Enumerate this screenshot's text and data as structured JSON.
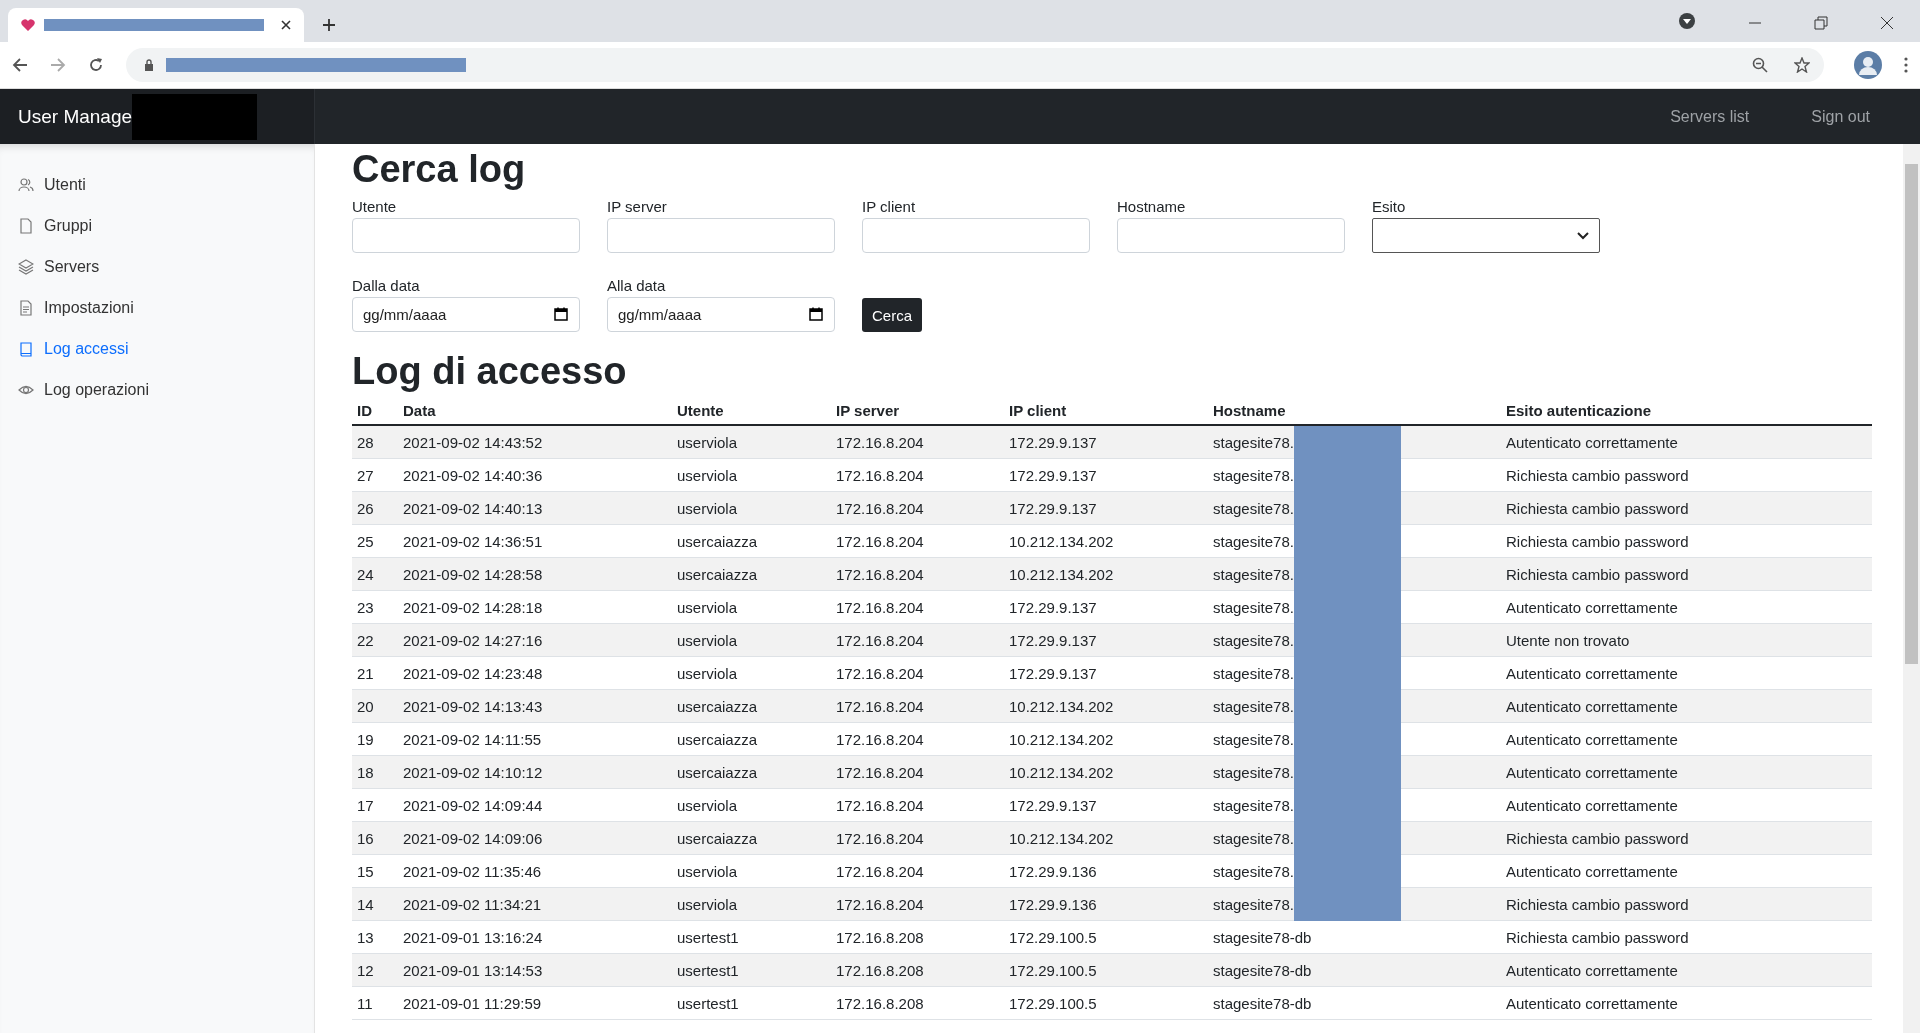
{
  "navbar": {
    "brand": "User Manage",
    "links": [
      "Servers list",
      "Sign out"
    ]
  },
  "sidebar": {
    "items": [
      {
        "label": "Utenti",
        "selected": false
      },
      {
        "label": "Gruppi",
        "selected": false
      },
      {
        "label": "Servers",
        "selected": false
      },
      {
        "label": "Impostazioni",
        "selected": false
      },
      {
        "label": "Log accessi",
        "selected": true
      },
      {
        "label": "Log operazioni",
        "selected": false
      }
    ]
  },
  "search": {
    "title": "Cerca log",
    "fields": [
      {
        "label": "Utente",
        "kind": "text"
      },
      {
        "label": "IP server",
        "kind": "text"
      },
      {
        "label": "IP client",
        "kind": "text"
      },
      {
        "label": "Hostname",
        "kind": "text"
      },
      {
        "label": "Esito",
        "kind": "select"
      }
    ],
    "date_fields": [
      {
        "label": "Dalla data",
        "placeholder": "gg/mm/aaaa"
      },
      {
        "label": "Alla data",
        "placeholder": "gg/mm/aaaa"
      }
    ],
    "button": "Cerca"
  },
  "table": {
    "title": "Log di accesso",
    "columns": [
      "ID",
      "Data",
      "Utente",
      "IP server",
      "IP client",
      "Hostname",
      "Esito autenticazione"
    ],
    "rows": [
      {
        "id": "28",
        "date": "2021-09-02 14:43:52",
        "user": "userviola",
        "ip_server": "172.16.8.204",
        "ip_client": "172.29.9.137",
        "hostname": "stagesite78.",
        "redacted": true,
        "outcome": "Autenticato correttamente"
      },
      {
        "id": "27",
        "date": "2021-09-02 14:40:36",
        "user": "userviola",
        "ip_server": "172.16.8.204",
        "ip_client": "172.29.9.137",
        "hostname": "stagesite78.",
        "redacted": true,
        "outcome": "Richiesta cambio password"
      },
      {
        "id": "26",
        "date": "2021-09-02 14:40:13",
        "user": "userviola",
        "ip_server": "172.16.8.204",
        "ip_client": "172.29.9.137",
        "hostname": "stagesite78.",
        "redacted": true,
        "outcome": "Richiesta cambio password"
      },
      {
        "id": "25",
        "date": "2021-09-02 14:36:51",
        "user": "usercaiazza",
        "ip_server": "172.16.8.204",
        "ip_client": "10.212.134.202",
        "hostname": "stagesite78.",
        "redacted": true,
        "outcome": "Richiesta cambio password"
      },
      {
        "id": "24",
        "date": "2021-09-02 14:28:58",
        "user": "usercaiazza",
        "ip_server": "172.16.8.204",
        "ip_client": "10.212.134.202",
        "hostname": "stagesite78.",
        "redacted": true,
        "outcome": "Richiesta cambio password"
      },
      {
        "id": "23",
        "date": "2021-09-02 14:28:18",
        "user": "userviola",
        "ip_server": "172.16.8.204",
        "ip_client": "172.29.9.137",
        "hostname": "stagesite78.",
        "redacted": true,
        "outcome": "Autenticato correttamente"
      },
      {
        "id": "22",
        "date": "2021-09-02 14:27:16",
        "user": "userviola",
        "ip_server": "172.16.8.204",
        "ip_client": "172.29.9.137",
        "hostname": "stagesite78.",
        "redacted": true,
        "outcome": "Utente non trovato"
      },
      {
        "id": "21",
        "date": "2021-09-02 14:23:48",
        "user": "userviola",
        "ip_server": "172.16.8.204",
        "ip_client": "172.29.9.137",
        "hostname": "stagesite78.",
        "redacted": true,
        "outcome": "Autenticato correttamente"
      },
      {
        "id": "20",
        "date": "2021-09-02 14:13:43",
        "user": "usercaiazza",
        "ip_server": "172.16.8.204",
        "ip_client": "10.212.134.202",
        "hostname": "stagesite78.",
        "redacted": true,
        "outcome": "Autenticato correttamente"
      },
      {
        "id": "19",
        "date": "2021-09-02 14:11:55",
        "user": "usercaiazza",
        "ip_server": "172.16.8.204",
        "ip_client": "10.212.134.202",
        "hostname": "stagesite78.",
        "redacted": true,
        "outcome": "Autenticato correttamente"
      },
      {
        "id": "18",
        "date": "2021-09-02 14:10:12",
        "user": "usercaiazza",
        "ip_server": "172.16.8.204",
        "ip_client": "10.212.134.202",
        "hostname": "stagesite78.",
        "redacted": true,
        "outcome": "Autenticato correttamente"
      },
      {
        "id": "17",
        "date": "2021-09-02 14:09:44",
        "user": "userviola",
        "ip_server": "172.16.8.204",
        "ip_client": "172.29.9.137",
        "hostname": "stagesite78.",
        "redacted": true,
        "outcome": "Autenticato correttamente"
      },
      {
        "id": "16",
        "date": "2021-09-02 14:09:06",
        "user": "usercaiazza",
        "ip_server": "172.16.8.204",
        "ip_client": "10.212.134.202",
        "hostname": "stagesite78.",
        "redacted": true,
        "outcome": "Richiesta cambio password"
      },
      {
        "id": "15",
        "date": "2021-09-02 11:35:46",
        "user": "userviola",
        "ip_server": "172.16.8.204",
        "ip_client": "172.29.9.136",
        "hostname": "stagesite78.",
        "redacted": true,
        "outcome": "Autenticato correttamente"
      },
      {
        "id": "14",
        "date": "2021-09-02 11:34:21",
        "user": "userviola",
        "ip_server": "172.16.8.204",
        "ip_client": "172.29.9.136",
        "hostname": "stagesite78.",
        "redacted": true,
        "outcome": "Richiesta cambio password"
      },
      {
        "id": "13",
        "date": "2021-09-01 13:16:24",
        "user": "usertest1",
        "ip_server": "172.16.8.208",
        "ip_client": "172.29.100.5",
        "hostname": "stagesite78-db",
        "redacted": false,
        "outcome": "Richiesta cambio password"
      },
      {
        "id": "12",
        "date": "2021-09-01 13:14:53",
        "user": "usertest1",
        "ip_server": "172.16.8.208",
        "ip_client": "172.29.100.5",
        "hostname": "stagesite78-db",
        "redacted": false,
        "outcome": "Autenticato correttamente"
      },
      {
        "id": "11",
        "date": "2021-09-01 11:29:59",
        "user": "usertest1",
        "ip_server": "172.16.8.208",
        "ip_client": "172.29.100.5",
        "hostname": "stagesite78-db",
        "redacted": false,
        "outcome": "Autenticato correttamente"
      }
    ]
  }
}
